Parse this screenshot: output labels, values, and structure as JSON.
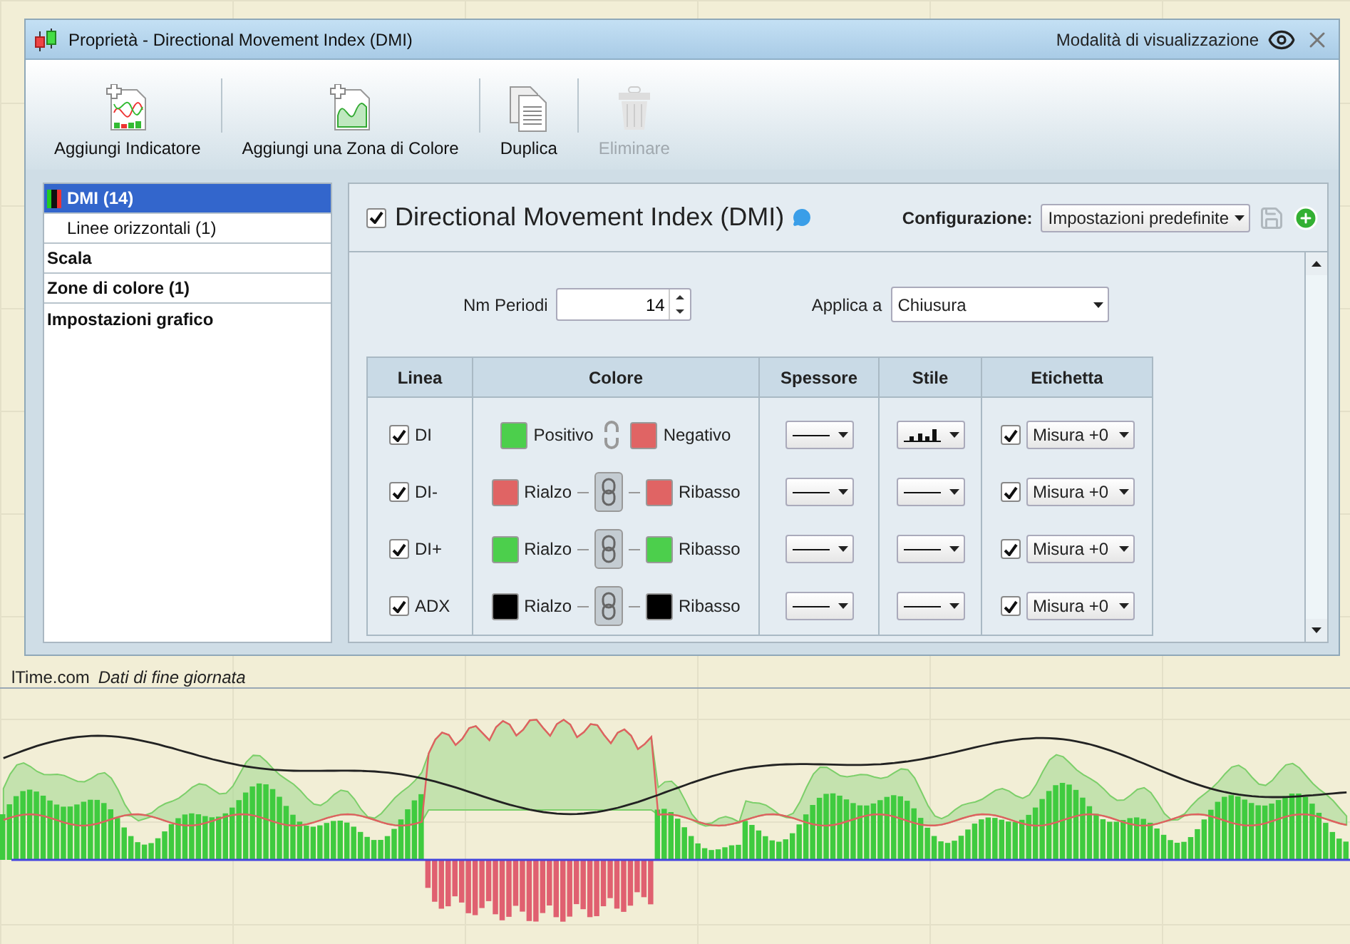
{
  "window": {
    "title": "Proprietà - Directional Movement Index (DMI)",
    "view_mode_label": "Modalità di visualizzazione"
  },
  "toolbar": [
    {
      "label": "Aggiungi Indicatore",
      "kind": "add_indicator",
      "disabled": false
    },
    {
      "label": "Aggiungi una Zona di Colore",
      "kind": "add_zone",
      "disabled": false
    },
    {
      "label": "Duplica",
      "kind": "duplicate",
      "disabled": false
    },
    {
      "label": "Eliminare",
      "kind": "delete",
      "disabled": true
    }
  ],
  "sidebar": {
    "items": [
      {
        "label": "DMI (14)",
        "selected": true,
        "children": [
          {
            "label": "Linee orizzontali (1)",
            "selected": false
          }
        ]
      },
      {
        "label": "Scala",
        "selected": false
      },
      {
        "label": "Zone di colore (1)",
        "selected": false
      },
      {
        "label": "Impostazioni grafico",
        "selected": false
      }
    ]
  },
  "panel": {
    "title": "Directional Movement Index (DMI)",
    "enabled": true,
    "config_label": "Configurazione:",
    "config_value": "Impostazioni predefinite",
    "periods_label": "Nm Periodi",
    "periods_value": "14",
    "apply_label": "Applica a",
    "apply_value": "Chiusura",
    "table": {
      "columns": [
        "Linea",
        "Colore",
        "Spessore",
        "Stile",
        "Etichetta"
      ],
      "rows": [
        {
          "line": "DI",
          "checked": true,
          "linked": false,
          "colors": [
            {
              "label": "Positivo",
              "color": "#4ccf4c"
            },
            {
              "label": "Negativo",
              "color": "#e06464"
            }
          ],
          "kind": "histogram",
          "label_checked": true,
          "label_value": "Misura +0"
        },
        {
          "line": "DI-",
          "checked": true,
          "linked": true,
          "colors": [
            {
              "label": "Rialzo",
              "color": "#e06464"
            },
            {
              "label": "Ribasso",
              "color": "#e06464"
            }
          ],
          "kind": "line",
          "label_checked": true,
          "label_value": "Misura +0"
        },
        {
          "line": "DI+",
          "checked": true,
          "linked": true,
          "colors": [
            {
              "label": "Rialzo",
              "color": "#4ccf4c"
            },
            {
              "label": "Ribasso",
              "color": "#4ccf4c"
            }
          ],
          "kind": "line",
          "label_checked": true,
          "label_value": "Misura +0"
        },
        {
          "line": "ADX",
          "checked": true,
          "linked": true,
          "colors": [
            {
              "label": "Rialzo",
              "color": "#000000"
            },
            {
              "label": "Ribasso",
              "color": "#000000"
            }
          ],
          "kind": "line",
          "label_checked": true,
          "label_value": "Misura +0"
        }
      ]
    }
  },
  "chart_caption": {
    "source": "lTime.com",
    "note": "Dati di fine giornata"
  }
}
